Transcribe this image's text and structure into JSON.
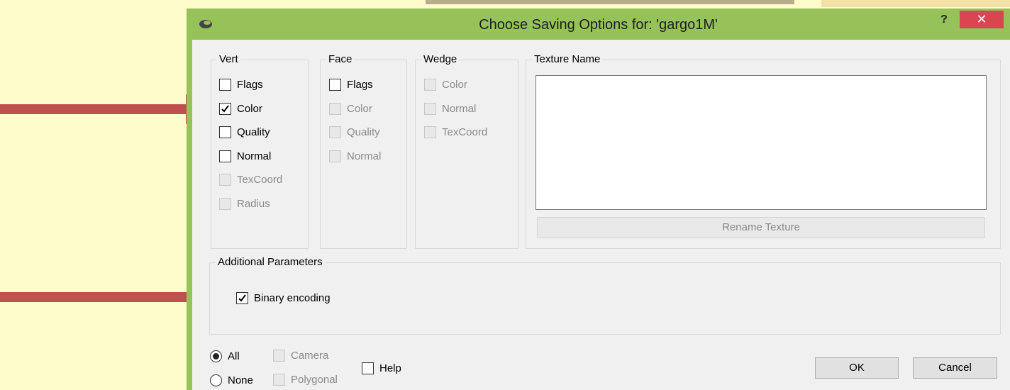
{
  "dialog": {
    "title": "Choose Saving Options for: 'gargo1M'",
    "help_symbol": "?",
    "close_symbol": "✕"
  },
  "vert": {
    "legend": "Vert",
    "items": [
      {
        "label": "Flags",
        "checked": false,
        "enabled": true
      },
      {
        "label": "Color",
        "checked": true,
        "enabled": true
      },
      {
        "label": "Quality",
        "checked": false,
        "enabled": true
      },
      {
        "label": "Normal",
        "checked": false,
        "enabled": true
      },
      {
        "label": "TexCoord",
        "checked": false,
        "enabled": false
      },
      {
        "label": "Radius",
        "checked": false,
        "enabled": false
      }
    ]
  },
  "face": {
    "legend": "Face",
    "items": [
      {
        "label": "Flags",
        "checked": false,
        "enabled": true
      },
      {
        "label": "Color",
        "checked": false,
        "enabled": false
      },
      {
        "label": "Quality",
        "checked": false,
        "enabled": false
      },
      {
        "label": "Normal",
        "checked": false,
        "enabled": false
      }
    ]
  },
  "wedge": {
    "legend": "Wedge",
    "items": [
      {
        "label": "Color",
        "checked": false,
        "enabled": false
      },
      {
        "label": "Normal",
        "checked": false,
        "enabled": false
      },
      {
        "label": "TexCoord",
        "checked": false,
        "enabled": false
      }
    ]
  },
  "texture": {
    "legend": "Texture Name",
    "rename_button": "Rename Texture"
  },
  "additional": {
    "legend": "Additional Parameters",
    "binary_encoding": {
      "label": "Binary encoding",
      "checked": true
    }
  },
  "bottom": {
    "radio_all": {
      "label": "All",
      "selected": true
    },
    "radio_none": {
      "label": "None",
      "selected": false
    },
    "camera": {
      "label": "Camera",
      "checked": false,
      "enabled": false
    },
    "polygonal": {
      "label": "Polygonal",
      "checked": false,
      "enabled": false
    },
    "help": {
      "label": "Help",
      "checked": false
    },
    "ok_button": "OK",
    "cancel_button": "Cancel"
  },
  "colors": {
    "background": "#fffccc",
    "titlebar": "#95c259",
    "close_button": "#d94550",
    "arrow": "#c0504d"
  }
}
